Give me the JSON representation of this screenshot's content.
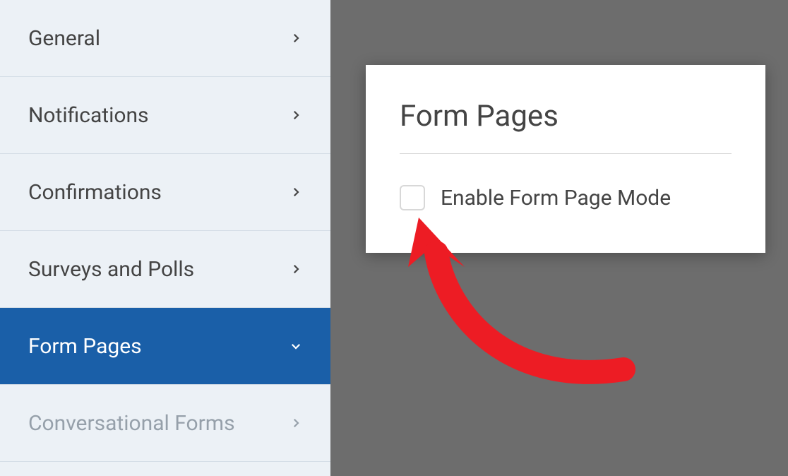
{
  "sidebar": {
    "items": [
      {
        "label": "General",
        "active": false,
        "faded": false,
        "expanded": false
      },
      {
        "label": "Notifications",
        "active": false,
        "faded": false,
        "expanded": false
      },
      {
        "label": "Confirmations",
        "active": false,
        "faded": false,
        "expanded": false
      },
      {
        "label": "Surveys and Polls",
        "active": false,
        "faded": false,
        "expanded": false
      },
      {
        "label": "Form Pages",
        "active": true,
        "faded": false,
        "expanded": true
      },
      {
        "label": "Conversational Forms",
        "active": false,
        "faded": true,
        "expanded": false
      }
    ]
  },
  "panel": {
    "title": "Form Pages",
    "checkbox_label": "Enable Form Page Mode",
    "checkbox_checked": false
  },
  "annotation": {
    "arrow_color": "#ed1c24"
  }
}
